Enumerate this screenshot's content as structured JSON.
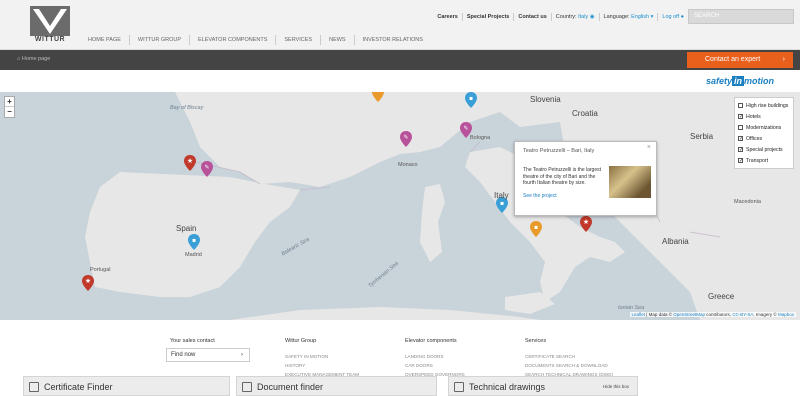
{
  "header": {
    "logo_text": "WITTUR",
    "main_nav": [
      "HOME PAGE",
      "WITTUR GROUP",
      "ELEVATOR COMPONENTS",
      "SERVICES",
      "NEWS",
      "INVESTOR RELATIONS"
    ],
    "top_nav": {
      "careers": "Careers",
      "special_projects": "Special Projects",
      "contact_us": "Contact us",
      "country_label": "Country:",
      "country_value": "Italy",
      "language_label": "Language:",
      "language_value": "English",
      "logoff": "Log off"
    },
    "search_placeholder": "SEARCH"
  },
  "breadcrumb": "Home page",
  "contact_button": "Contact an expert",
  "brand_tag": {
    "part1": "safety",
    "part2": "in",
    "part3": "motion"
  },
  "map": {
    "zoom_in": "+",
    "zoom_out": "−",
    "labels": {
      "bay_of_biscay": "Bay of Biscay",
      "spain": "Spain",
      "portugal": "Portugal",
      "madrid": "Madrid",
      "monaco": "Monaco",
      "slovenia": "Slovenia",
      "croatia": "Croatia",
      "serbia": "Serbia",
      "albania": "Albania",
      "macedonia": "Macedonia",
      "greece": "Greece",
      "balearic_sea": "Balearic Sea",
      "tyrrhenian_sea": "Tyrrhenian Sea",
      "ionian_sea": "Ionian Sea",
      "italy": "Italy",
      "bologna": "Bologna"
    },
    "legend": [
      {
        "label": "High rise buildings",
        "checked": false
      },
      {
        "label": "Hotels",
        "checked": true
      },
      {
        "label": "Modernizations",
        "checked": false
      },
      {
        "label": "Offices",
        "checked": true
      },
      {
        "label": "Special projects",
        "checked": true
      },
      {
        "label": "Transport",
        "checked": true
      }
    ],
    "popup": {
      "title": "Teatro Petruzzelli – Bari, Italy",
      "body": "The Teatro Petruzzelli is the largest theatre of the city of Bari and the fourth Italian theatre by size.",
      "link": "See the project",
      "close": "×"
    },
    "attribution": {
      "leaflet": "Leaflet",
      "text": " | Map data © ",
      "osm": "OpenStreetMap",
      "text2": " contributors, ",
      "license": "CC-BY-SA",
      "text3": ", Imagery © ",
      "mapbox": "Mapbox"
    }
  },
  "footer": {
    "sales_contact": "Your sales contact",
    "find_now": "Find now",
    "col_wittur": {
      "head": "Wittur Group",
      "items": [
        "SAFETY IN MOTION",
        "HISTORY",
        "EXECUTIVE MANAGEMENT TEAM"
      ]
    },
    "col_components": {
      "head": "Elevator components",
      "items": [
        "LANDING DOORS",
        "CAR DOORS",
        "OVERSPEED GOVERNORS"
      ]
    },
    "col_services": {
      "head": "Services",
      "items": [
        "CERTIFICATE SEARCH",
        "DOCUMENTS SEARCH & DOWNLOAD",
        "SEARCH TECHNICAL DRAWINGS (DWG)"
      ]
    }
  },
  "tabs": {
    "certificate": "Certificate Finder",
    "document": "Document finder",
    "technical": "Technical drawings",
    "hide": "Hide this box"
  },
  "colors": {
    "accent_orange": "#e8601c",
    "brand_blue": "#1a7fc1",
    "dark_bar": "#444444"
  }
}
